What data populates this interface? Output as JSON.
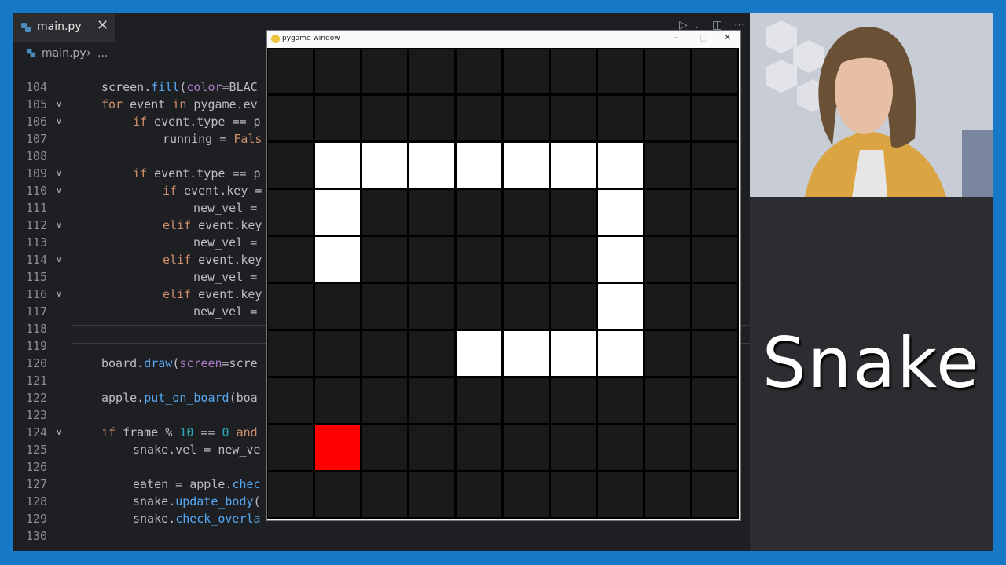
{
  "editor": {
    "tab_label": "main.py",
    "close_glyph": "✕",
    "breadcrumb": {
      "file": "main.py",
      "separator": "›",
      "more": "..."
    },
    "toolbar_icons": [
      "run-icon",
      "chevron-down-icon",
      "split-editor-icon",
      "more-icon"
    ],
    "lines": [
      {
        "num": "104",
        "fold": false
      },
      {
        "num": "105",
        "fold": true
      },
      {
        "num": "106",
        "fold": true
      },
      {
        "num": "107",
        "fold": false
      },
      {
        "num": "108",
        "fold": false
      },
      {
        "num": "109",
        "fold": true
      },
      {
        "num": "110",
        "fold": true
      },
      {
        "num": "111",
        "fold": false
      },
      {
        "num": "112",
        "fold": true
      },
      {
        "num": "113",
        "fold": false
      },
      {
        "num": "114",
        "fold": true
      },
      {
        "num": "115",
        "fold": false
      },
      {
        "num": "116",
        "fold": true
      },
      {
        "num": "117",
        "fold": false
      },
      {
        "num": "118",
        "fold": false
      },
      {
        "num": "119",
        "fold": false
      },
      {
        "num": "120",
        "fold": false
      },
      {
        "num": "121",
        "fold": false
      },
      {
        "num": "122",
        "fold": false
      },
      {
        "num": "123",
        "fold": false
      },
      {
        "num": "124",
        "fold": true
      },
      {
        "num": "125",
        "fold": false
      },
      {
        "num": "126",
        "fold": false
      },
      {
        "num": "127",
        "fold": false
      },
      {
        "num": "128",
        "fold": false
      },
      {
        "num": "129",
        "fold": false
      },
      {
        "num": "130",
        "fold": false
      }
    ],
    "code": {
      "l104": [
        "screen",
        ".",
        "fill",
        "(",
        "color",
        "=BLAC"
      ],
      "l105": [
        "for",
        " event ",
        "in",
        " pygame.ev"
      ],
      "l106": [
        "if",
        " event.type ",
        "==",
        " p"
      ],
      "l107": [
        "running = ",
        "Fals"
      ],
      "l109": [
        "if",
        " event.type ",
        "==",
        " p"
      ],
      "l110": [
        "if",
        " event.key ="
      ],
      "l111": [
        "new_vel ="
      ],
      "l112": [
        "elif",
        " event.key"
      ],
      "l113": [
        "new_vel ="
      ],
      "l114": [
        "elif",
        " event.key"
      ],
      "l115": [
        "new_vel ="
      ],
      "l116": [
        "elif",
        " event.key"
      ],
      "l117": [
        "new_vel ="
      ],
      "l120": [
        "board",
        ".",
        "draw",
        "(",
        "screen",
        "=scre"
      ],
      "l122": [
        "apple",
        ".",
        "put_on_board",
        "(boa"
      ],
      "l124": [
        "if",
        " frame % ",
        "10",
        " == ",
        "0",
        " and"
      ],
      "l125": [
        "snake.vel = new_ve"
      ],
      "l127": [
        "eaten = apple.",
        "chec"
      ],
      "l128": [
        "snake.",
        "update_body",
        "("
      ],
      "l129": [
        "snake.",
        "check_overla"
      ]
    }
  },
  "pygame_window": {
    "title": "pygame window",
    "minimize": "–",
    "maximize": "□",
    "close": "✕",
    "grid": {
      "cols": 10,
      "rows": 10
    },
    "snake_cells": [
      [
        1,
        2
      ],
      [
        2,
        2
      ],
      [
        3,
        2
      ],
      [
        4,
        2
      ],
      [
        5,
        2
      ],
      [
        6,
        2
      ],
      [
        7,
        2
      ],
      [
        1,
        3
      ],
      [
        1,
        4
      ],
      [
        7,
        3
      ],
      [
        7,
        4
      ],
      [
        7,
        5
      ],
      [
        4,
        6
      ],
      [
        5,
        6
      ],
      [
        6,
        6
      ],
      [
        7,
        6
      ]
    ],
    "apple_cell": [
      1,
      8
    ],
    "colors": {
      "snake": "#ffffff",
      "apple": "#ff0000",
      "cell": "#1a1a1a",
      "grid_line": "#000000"
    }
  },
  "overlay": {
    "title": "Snake"
  },
  "colors": {
    "border": "#1878c8",
    "editor_bg": "#1e1f22",
    "keyword": "#cf8e6d",
    "function": "#56a8f5",
    "number": "#2aacb8",
    "param": "#aa7cc4"
  }
}
